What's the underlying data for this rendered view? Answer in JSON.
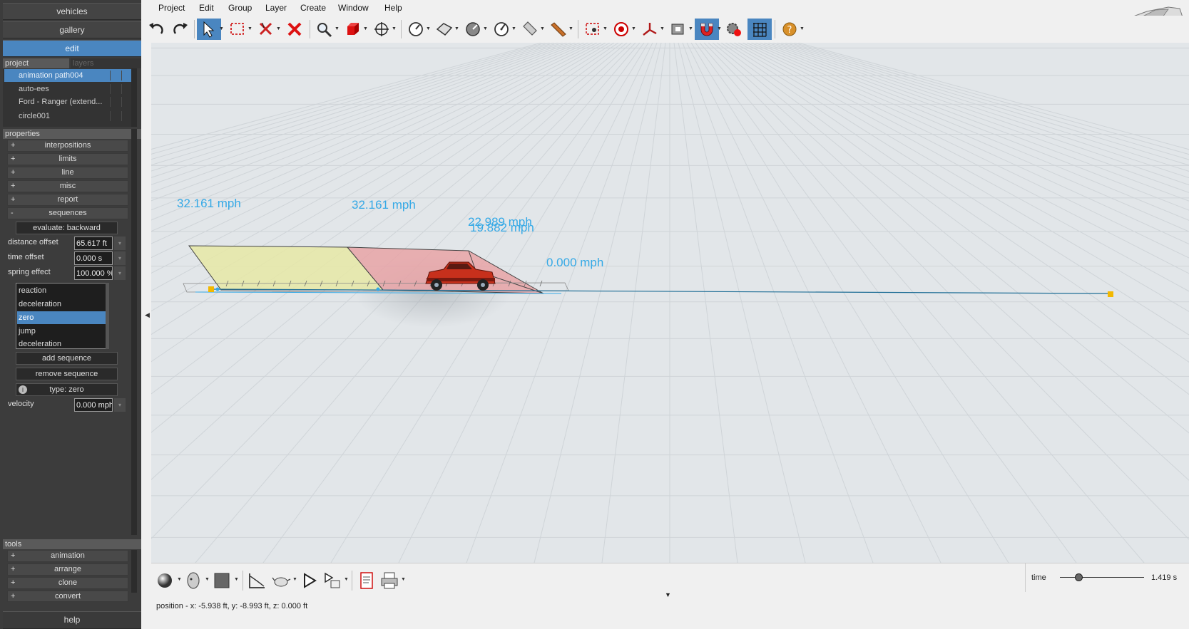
{
  "left_panel": {
    "top_buttons": {
      "vehicles": "vehicles",
      "gallery": "gallery",
      "edit": "edit"
    },
    "tabs": {
      "project": "project",
      "layers": "layers"
    },
    "project_items": [
      "animation path004",
      "auto-ees",
      "Ford - Ranger (extend...",
      "circle001"
    ],
    "properties_header": "properties",
    "property_groups": {
      "interpositions": "interpositions",
      "limits": "limits",
      "line": "line",
      "misc": "misc",
      "report": "report",
      "sequences": "sequences"
    },
    "collapsed_sign": "+",
    "expanded_sign": "-",
    "evaluate_button": "evaluate: backward",
    "fields": {
      "distance_offset": {
        "label": "distance offset",
        "value": "65.617 ft"
      },
      "time_offset": {
        "label": "time offset",
        "value": "0.000 s"
      },
      "spring_effect": {
        "label": "spring effect",
        "value": "100.000 %"
      },
      "velocity": {
        "label": "velocity",
        "value": "0.000 mph"
      }
    },
    "sequence_list": [
      "reaction",
      "deceleration",
      "zero",
      "jump",
      "deceleration"
    ],
    "sequence_selected": "zero",
    "add_sequence": "add sequence",
    "remove_sequence": "remove sequence",
    "type_button": "type: zero",
    "tools_header": "tools",
    "tools": {
      "animation": "animation",
      "arrange": "arrange",
      "clone": "clone",
      "convert": "convert"
    },
    "help": "help"
  },
  "menu": {
    "project": "Project",
    "edit": "Edit",
    "group": "Group",
    "layer": "Layer",
    "create": "Create",
    "window": "Window",
    "help": "Help"
  },
  "toolbar_icons": [
    "undo-icon",
    "redo-icon",
    "select-arrow-icon",
    "box-select-icon",
    "delete-cross-icon",
    "red-x-icon",
    "zoom-icon",
    "red-cube-icon",
    "move-icon",
    "measure-icon",
    "surface-icon",
    "gauge-icon",
    "dial-icon",
    "cylinder-icon",
    "ruler-icon",
    "camera-target-icon",
    "record-icon",
    "axis-icon",
    "light-icon",
    "magnet-icon",
    "gear-record-icon",
    "grid-icon",
    "help-icon"
  ],
  "viewport": {
    "speed_labels": {
      "s1": "32.161 mph",
      "s2": "32.161 mph",
      "s3": "22.989 mph",
      "s4": "19.882 mph",
      "s5": "0.000 mph"
    }
  },
  "bottom": {
    "time_label": "time",
    "time_value": "1.419 s",
    "time_slider": {
      "value": 1.419,
      "fraction": 0.23
    },
    "status": "position - x: -5.938 ft, y: -8.993 ft, z: 0.000 ft"
  },
  "colors": {
    "accent": "#4a86c0",
    "speed_text": "#35a9e6",
    "zone_yellow": "#e6e8a6",
    "zone_red": "#e8a3a6",
    "car_red": "#c7301c"
  }
}
